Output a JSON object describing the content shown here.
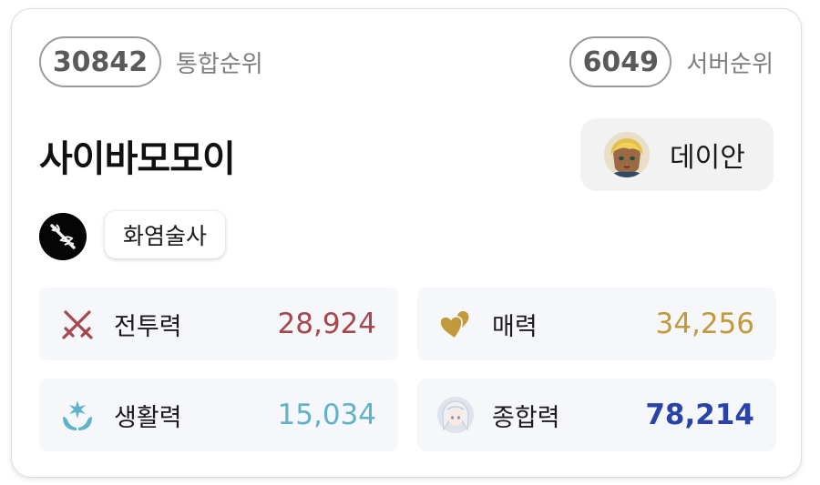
{
  "rank": {
    "total": {
      "value": "30842",
      "label": "통합순위"
    },
    "server": {
      "value": "6049",
      "label": "서버순위"
    }
  },
  "character": {
    "name": "사이바모모이",
    "class": "화염술사",
    "class_icon": "flame-sorcerer-class-icon"
  },
  "server": {
    "name": "데이안",
    "avatar_icon": "server-character-avatar"
  },
  "stats": [
    {
      "key": "combat",
      "label": "전투력",
      "value": "28,924",
      "color": "#a6474c",
      "icon": "crossed-swords-icon"
    },
    {
      "key": "charm",
      "label": "매력",
      "value": "34,256",
      "color": "#c39a3b",
      "icon": "hearts-icon"
    },
    {
      "key": "life",
      "label": "생활력",
      "value": "15,034",
      "color": "#5fb3c9",
      "icon": "hand-sparkle-icon"
    },
    {
      "key": "total",
      "label": "종합력",
      "value": "78,214",
      "color": "#2a43a7",
      "icon": "character-portrait-icon"
    }
  ]
}
